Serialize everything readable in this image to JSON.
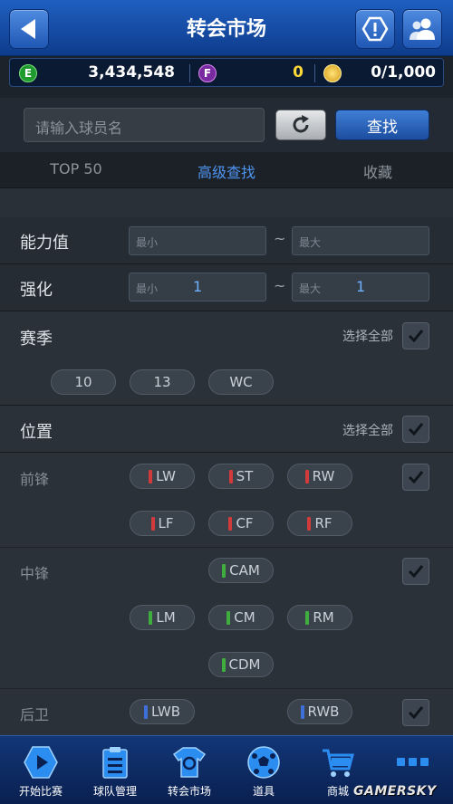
{
  "header": {
    "title": "转会市场"
  },
  "currency": {
    "e_letter": "E",
    "e_value": "3,434,548",
    "f_letter": "F",
    "f_value": "0",
    "coin_value": "0/1,000"
  },
  "search": {
    "placeholder": "请输入球员名",
    "find_label": "查找"
  },
  "tabs": [
    {
      "label": "TOP 50"
    },
    {
      "label": "高级查找"
    },
    {
      "label": "收藏"
    }
  ],
  "filters": {
    "ability": {
      "label": "能力值",
      "min_placeholder": "最小",
      "max_placeholder": "最大"
    },
    "enhance": {
      "label": "强化",
      "min_placeholder": "最小",
      "min_value": "1",
      "max_placeholder": "最大",
      "max_value": "1"
    },
    "season": {
      "label": "赛季",
      "select_all": "选择全部",
      "options": [
        "10",
        "13",
        "WC"
      ]
    },
    "position": {
      "label": "位置",
      "select_all": "选择全部",
      "forward": {
        "label": "前锋",
        "row1": [
          "LW",
          "ST",
          "RW"
        ],
        "row2": [
          "LF",
          "CF",
          "RF"
        ]
      },
      "midfield": {
        "label": "中锋",
        "row1": [
          "CAM"
        ],
        "row2": [
          "LM",
          "CM",
          "RM"
        ],
        "row3": [
          "CDM"
        ]
      },
      "defense": {
        "label": "后卫",
        "row1": [
          "LWB",
          "RWB"
        ]
      }
    }
  },
  "nav": [
    {
      "label": "开始比赛",
      "icon": "play-icon"
    },
    {
      "label": "球队管理",
      "icon": "clipboard-icon"
    },
    {
      "label": "转会市场",
      "icon": "jersey-icon"
    },
    {
      "label": "道具",
      "icon": "soccer-ball-icon"
    },
    {
      "label": "商城",
      "icon": "cart-icon"
    },
    {
      "label": "",
      "icon": "more-icon"
    }
  ],
  "watermark": "GAMERSKY",
  "colors": {
    "accent": "#4f95f0",
    "header": "#1f5fc0"
  }
}
